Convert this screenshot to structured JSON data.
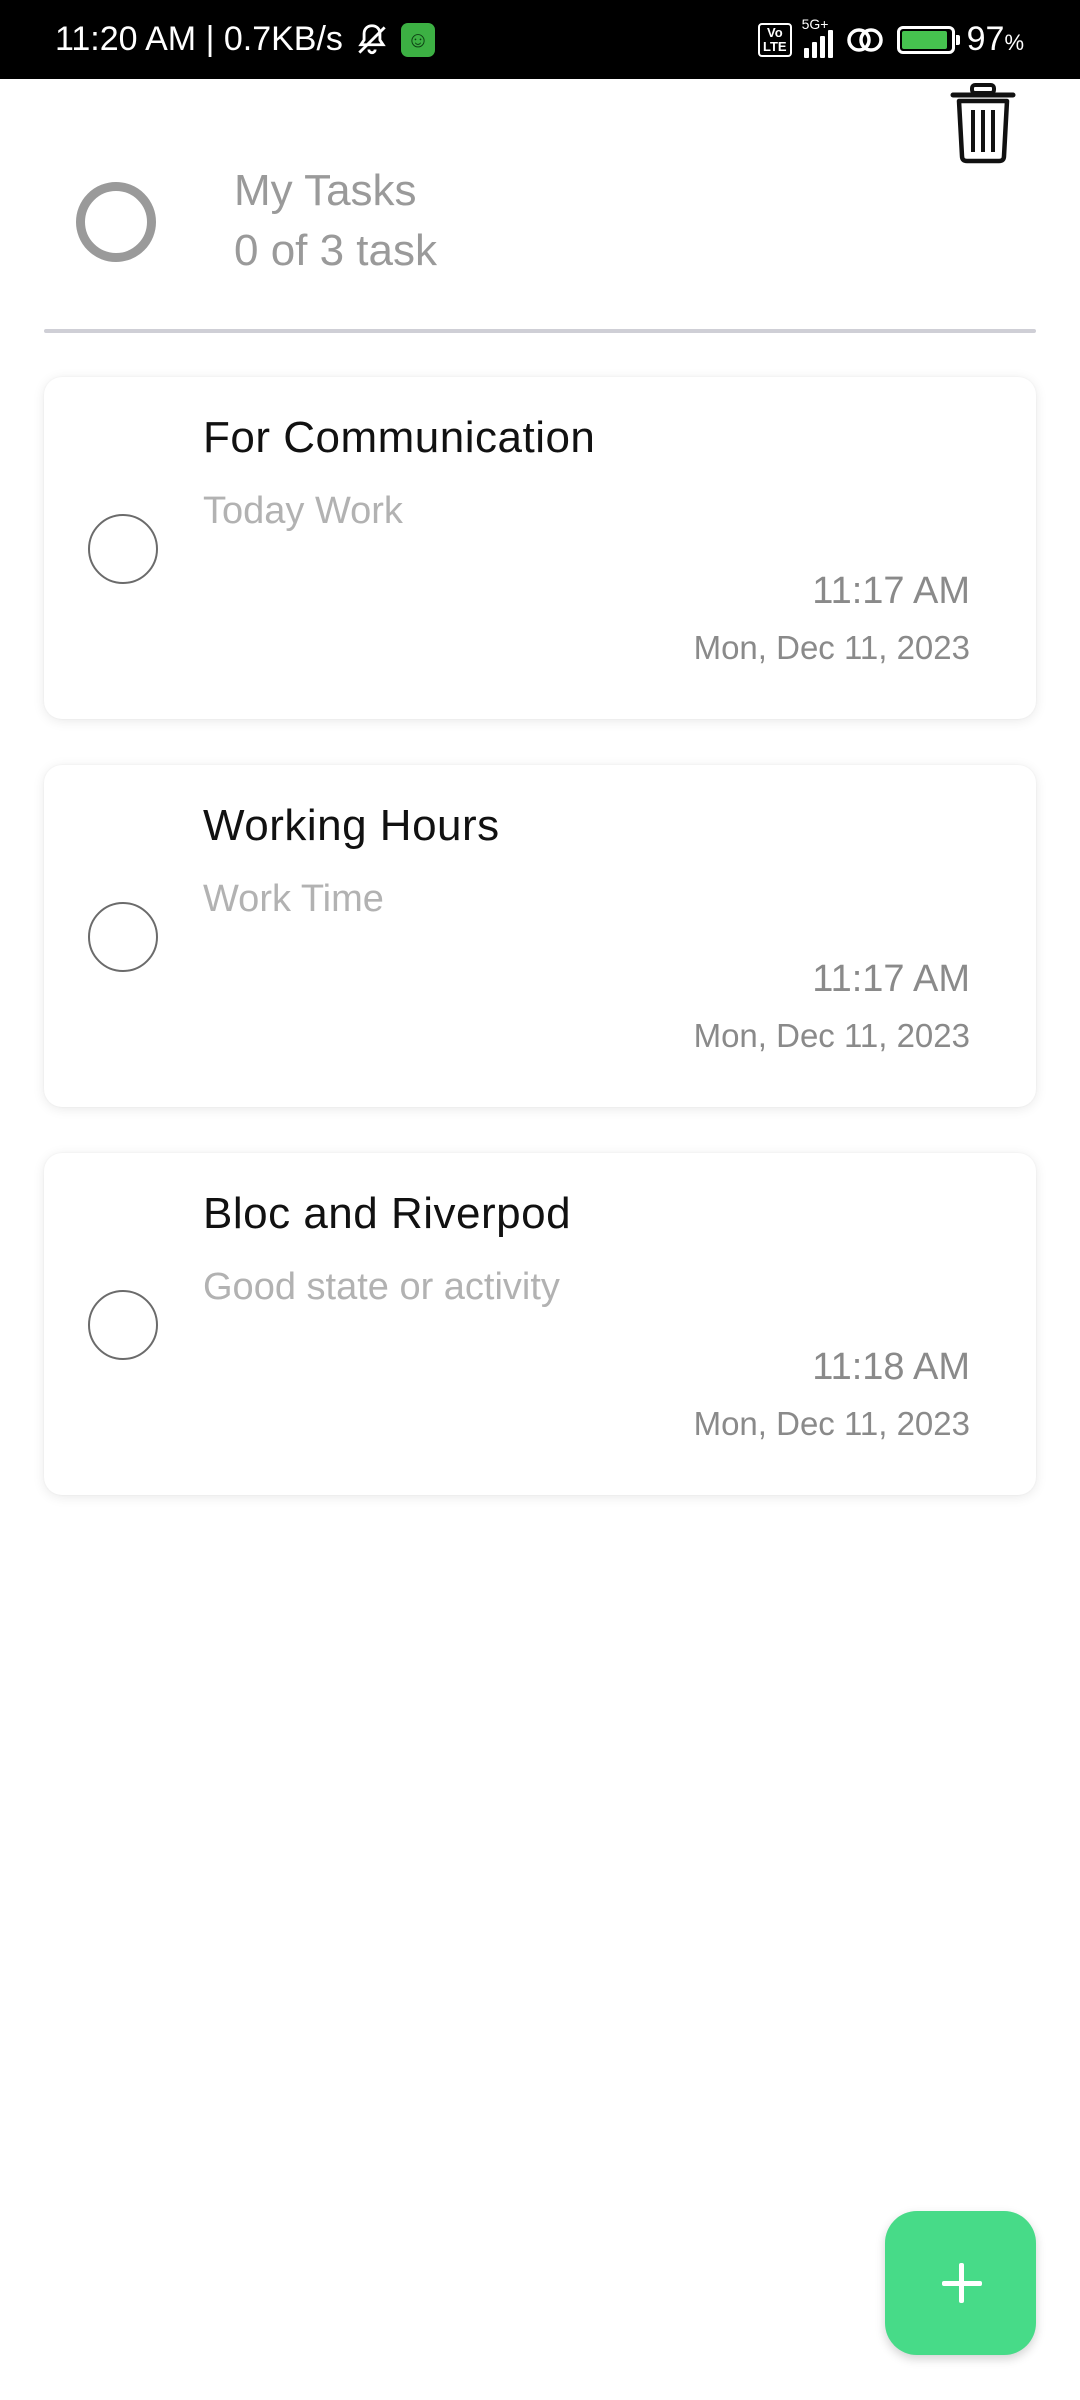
{
  "status_bar": {
    "time_speed": "11:20 AM | 0.7KB/s",
    "volte_top": "Vo",
    "volte_bottom": "LTE",
    "network_type": "5G+",
    "battery_percent": "97",
    "battery_percent_sign": "%",
    "battery_level": 0.97,
    "icons": [
      "mute-bell-icon",
      "android-app-icon",
      "volte-icon",
      "signal-icon",
      "hotspot-link-icon",
      "battery-charging-icon"
    ]
  },
  "header": {
    "title": "My Tasks",
    "subtitle": "0 of 3 task",
    "progress": 0,
    "delete_icon": "trash-icon"
  },
  "tasks": [
    {
      "title": "For Communication",
      "description": "Today Work",
      "time": "11:17 AM",
      "date": "Mon, Dec 11, 2023",
      "completed": false
    },
    {
      "title": "Working Hours",
      "description": "Work Time",
      "time": "11:17 AM",
      "date": "Mon, Dec 11, 2023",
      "completed": false
    },
    {
      "title": "Bloc and Riverpod",
      "description": "Good state or activity",
      "time": "11:18 AM",
      "date": "Mon, Dec 11, 2023",
      "completed": false
    }
  ],
  "fab": {
    "icon": "plus-icon"
  },
  "colors": {
    "accent": "#47DB88",
    "muted_text": "#9A9A9A",
    "divider": "#CFCFD6"
  }
}
